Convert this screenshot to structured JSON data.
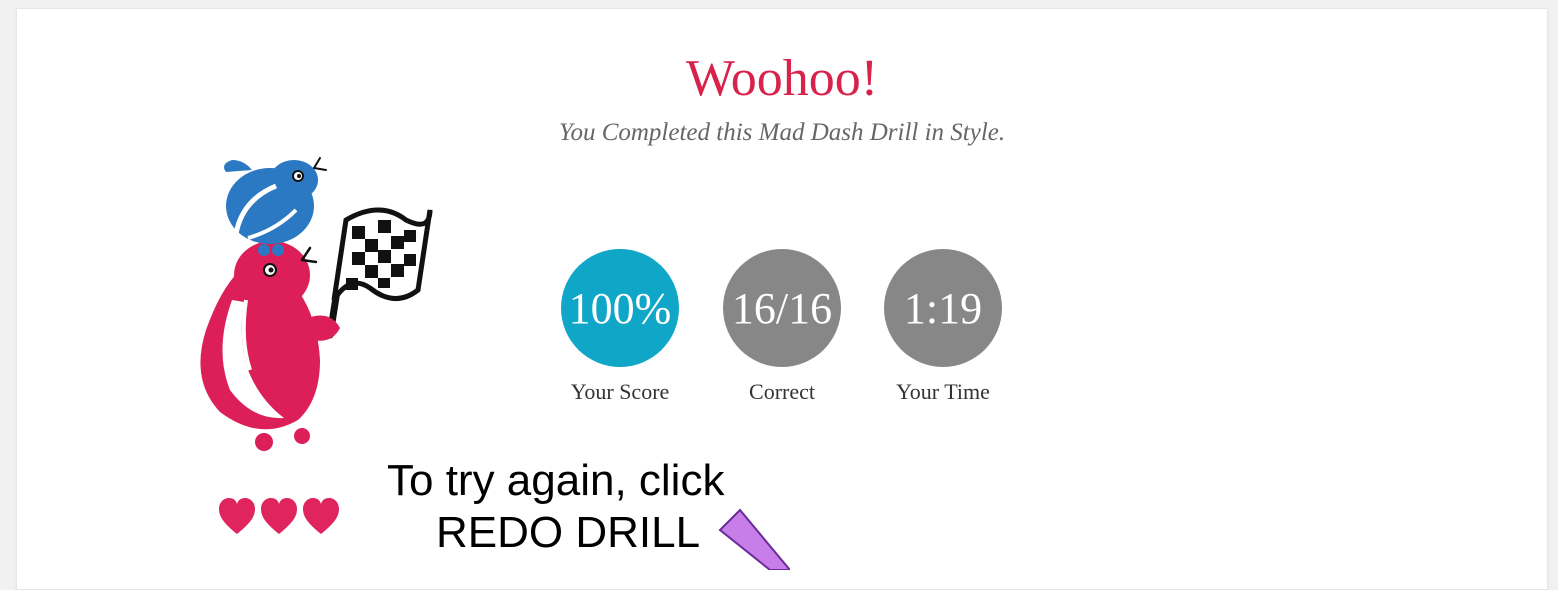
{
  "result": {
    "title": "Woohoo!",
    "subtitle": "You Completed this Mad Dash Drill in Style."
  },
  "stats": {
    "score": {
      "value": "100%",
      "label": "Your Score",
      "color": "#0fa6c8"
    },
    "correct": {
      "value": "16/16",
      "label": "Correct",
      "color": "#878787"
    },
    "time": {
      "value": "1:19",
      "label": "Your Time",
      "color": "#878787"
    }
  },
  "lives": {
    "count": 3,
    "icon": "heart-icon",
    "color": "#e0245e"
  },
  "hint": {
    "line1": "To try again, click",
    "line2": "REDO DRILL"
  },
  "colors": {
    "accent": "#d8224c",
    "mascot_blue": "#2b79c2",
    "mascot_red": "#dc1f59",
    "pointer": "#c77ee8"
  }
}
